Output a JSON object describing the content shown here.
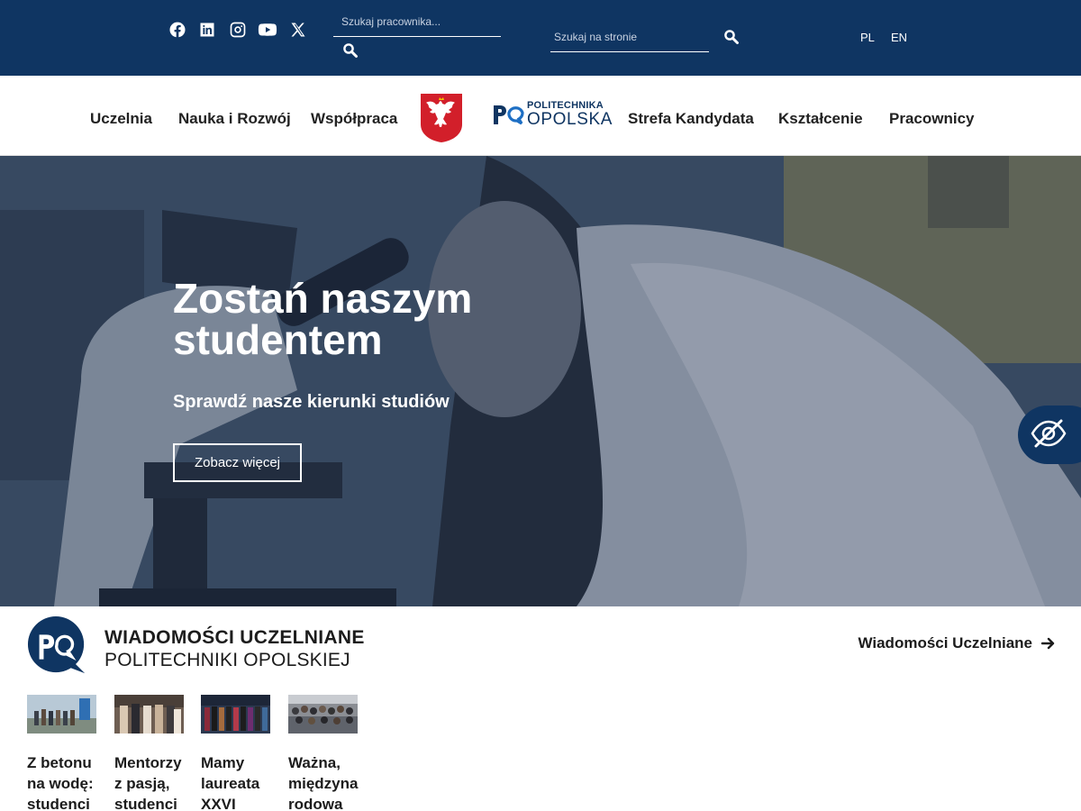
{
  "topbar": {
    "social_icons": [
      "facebook-icon",
      "linkedin-icon",
      "instagram-icon",
      "youtube-icon",
      "x-icon"
    ],
    "worker_search": {
      "placeholder": "Szukaj pracownika...",
      "value": ""
    },
    "site_search": {
      "placeholder": "Szukaj na stronie",
      "value": ""
    },
    "languages": [
      "PL",
      "EN"
    ]
  },
  "nav": {
    "items": [
      "Uczelnia",
      "Nauka i Rozwój",
      "Współpraca",
      "Strefa Kandydata",
      "Kształcenie",
      "Pracownicy"
    ],
    "logo": {
      "line1": "POLITECHNIKA",
      "line2": "OPOLSKA"
    }
  },
  "hero": {
    "title": "Zostań naszym studentem",
    "subtitle": "Sprawdź nasze kierunki studiów",
    "button": "Zobacz więcej"
  },
  "news": {
    "logo_line1": "WIADOMOŚCI UCZELNIANE",
    "logo_line2": "POLITECHNIKI OPOLSKIEJ",
    "link": "Wiadomości Uczelniane",
    "items": [
      {
        "title": "Z betonu na wodę: studenci"
      },
      {
        "title": "Mentorzy z pasją, studenci"
      },
      {
        "title": "Mamy laureata XXVI"
      },
      {
        "title": "Ważna, międzyna rodowa"
      }
    ]
  },
  "colors": {
    "brand": "#0f3562",
    "accent": "#1e6fc4"
  }
}
